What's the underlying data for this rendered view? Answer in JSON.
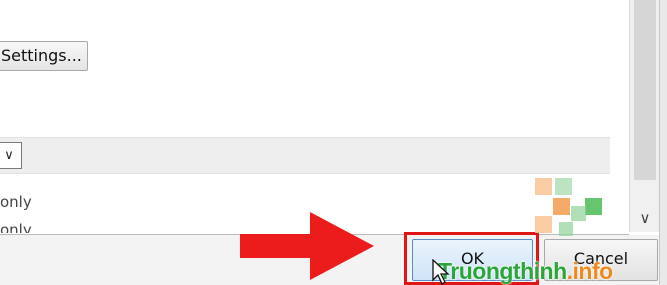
{
  "dialog": {
    "settings_button_label": "Settings...",
    "dropdown_glyph": "∨",
    "list_items": [
      "only",
      "only"
    ],
    "scroll_down_glyph": "∨"
  },
  "footer": {
    "ok_label": "OK",
    "cancel_label": "Cancel"
  },
  "watermark": {
    "name": "Truongthinh",
    "suffix": ".info"
  },
  "colors": {
    "highlight": "#e01515",
    "arrow": "#ec1c1c",
    "brand_green": "#2aa63a",
    "brand_orange": "#f08a1c"
  },
  "icons": [
    "red-arrow-icon",
    "mouse-cursor-icon",
    "logo-squares-icon",
    "chevron-down-icon"
  ]
}
